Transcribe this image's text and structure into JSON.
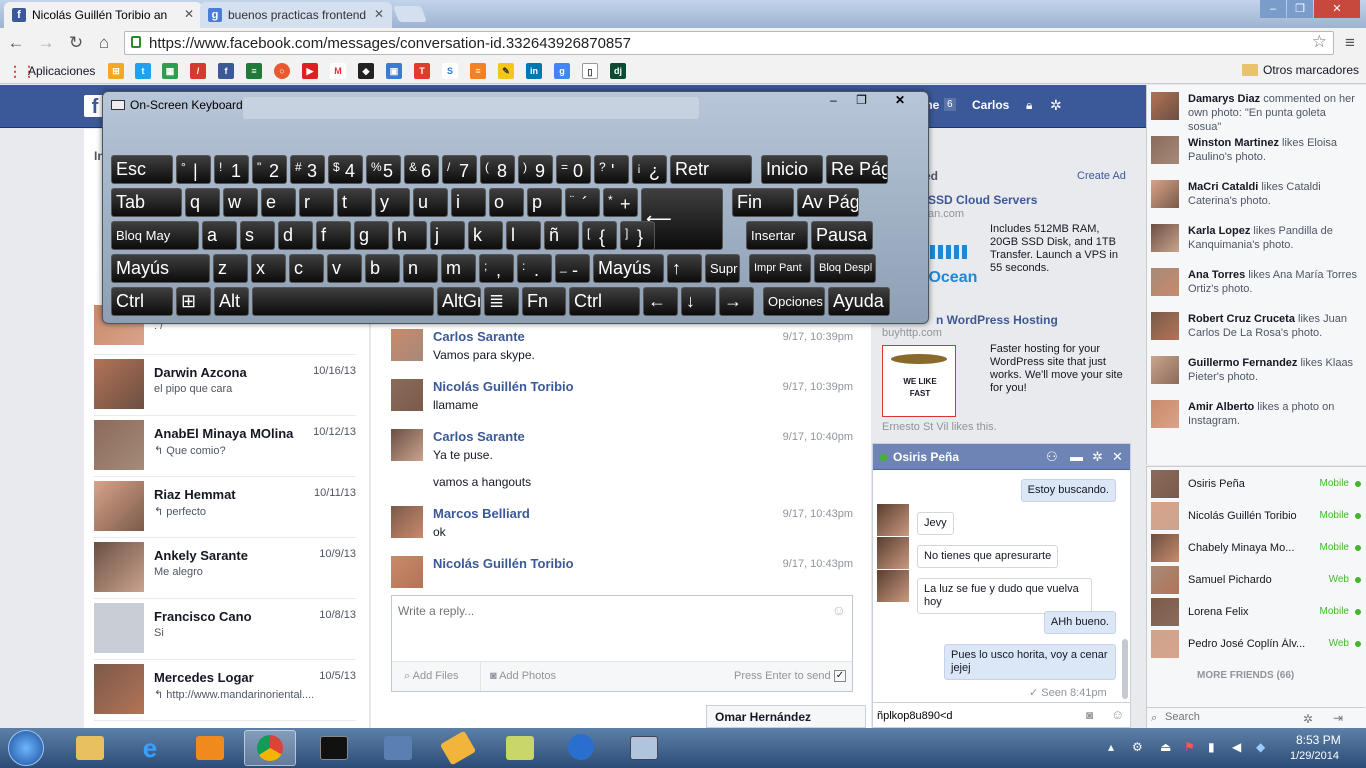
{
  "browser": {
    "tabs": [
      {
        "title": "Nicolás Guillén Toribio an",
        "icon": "facebook-icon",
        "active": true
      },
      {
        "title": "buenos practicas frontend",
        "icon": "google-icon",
        "active": false
      }
    ],
    "url": "https://www.facebook.com/messages/conversation-id.332643926870857",
    "bookmarks_label": "Aplicaciones",
    "other_bookmarks": "Otros marcadores"
  },
  "fb": {
    "home_label": "me",
    "home_count": "6",
    "user": "Carlos",
    "left_title": "Inbox",
    "conversations": [
      {
        "name": "",
        "snippet": ": /",
        "date": ""
      },
      {
        "name": "Darwin Azcona",
        "snippet": "el pipo que cara",
        "date": "10/16/13"
      },
      {
        "name": "AnabEl Minaya MOlina",
        "snippet": "↰ Que comio?",
        "date": "10/12/13"
      },
      {
        "name": "Riaz Hemmat",
        "snippet": "↰ perfecto",
        "date": "10/11/13"
      },
      {
        "name": "Ankely Sarante",
        "snippet": "Me alegro",
        "date": "10/9/13"
      },
      {
        "name": "Francisco Cano",
        "snippet": "Si",
        "date": "10/8/13"
      },
      {
        "name": "Mercedes Logar",
        "snippet": "↰ http://www.mandarinoriental....",
        "date": "10/5/13"
      }
    ],
    "messages": [
      {
        "name": "Carlos Sarante",
        "text": "Vamos para skype.",
        "time": "9/17, 10:39pm"
      },
      {
        "name": "Nicolás Guillén Toribio",
        "text": "llamame",
        "time": "9/17, 10:39pm"
      },
      {
        "name": "Carlos Sarante",
        "text": "Ya te puse.",
        "text2": "vamos a hangouts",
        "time": "9/17, 10:40pm"
      },
      {
        "name": "Marcos Belliard",
        "text": "ok",
        "time": "9/17, 10:43pm"
      },
      {
        "name": "Nicolás Guillén Toribio",
        "text": "",
        "time": "9/17, 10:43pm"
      }
    ],
    "reply_placeholder": "Write a reply...",
    "add_files": "Add Files",
    "add_photos": "Add Photos",
    "press_enter": "Press Enter to send",
    "ads": {
      "header": "ed",
      "create_ad": "Create Ad",
      "ad1_title": "SSD Cloud Servers",
      "ad1_sub": "an.com",
      "ad1_text": "Includes 512MB RAM, 20GB SSD Disk, and 1TB Transfer. Launch a VPS in 55 seconds.",
      "ad1_logo": "lOcean",
      "ad2_title": "n WordPress Hosting",
      "ad2_sub": "buyhttp.com",
      "ad2_text": "Faster hosting for your WordPress site that just works. We'll move your site for you!",
      "ad2_logo": "WE LIKE FAST",
      "ad2_like": "Ernesto St Vil likes this."
    }
  },
  "chat": {
    "name": "Osiris Peña",
    "messages": [
      {
        "text": "Estoy buscando.",
        "me": true
      },
      {
        "text": "Jevy",
        "me": false
      },
      {
        "text": "No tienes que apresurarte",
        "me": false
      },
      {
        "text": "La luz se fue y dudo que vuelva hoy",
        "me": false
      },
      {
        "text": "AHh bueno.",
        "me": true
      },
      {
        "text": "Pues lo usco horita, voy a cenar jejej",
        "me": true
      }
    ],
    "seen": "✓ Seen 8:41pm",
    "input_value": "ñplkop8u890<d",
    "other_tab": "Omar Hernández"
  },
  "ticker": [
    {
      "name": "Damarys Diaz",
      "rest": " commented on her own photo: \"En punta goleta sosua\""
    },
    {
      "name": "Winston Martinez",
      "rest": " likes Eloisa Paulino's photo."
    },
    {
      "name": "MaCri Cataldi",
      "rest": " likes Cataldi Caterina's photo."
    },
    {
      "name": "Karla Lopez",
      "rest": " likes Pandilla de Kanquimania's photo."
    },
    {
      "name": "Ana Torres",
      "rest": " likes Ana María Torres Ortiz's photo."
    },
    {
      "name": "Robert Cruz Cruceta",
      "rest": " likes Juan Carlos De La Rosa's photo."
    },
    {
      "name": "Guillermo Fernandez",
      "rest": " likes Klaas Pieter's photo."
    },
    {
      "name": "Amir Alberto",
      "rest": " likes a photo on Instagram."
    }
  ],
  "friends": [
    {
      "name": "Osiris Peña",
      "status": "Mobile"
    },
    {
      "name": "Nicolás Guillén Toribio",
      "status": "Mobile"
    },
    {
      "name": "Chabely Minaya Mo...",
      "status": "Mobile"
    },
    {
      "name": "Samuel Pichardo",
      "status": "Web"
    },
    {
      "name": "Lorena Felix",
      "status": "Mobile"
    },
    {
      "name": "Pedro José Coplín Álv...",
      "status": "Web"
    }
  ],
  "more_friends": "MORE FRIENDS (66)",
  "buddy_search": "Search",
  "osk": {
    "title": "On-Screen Keyboard",
    "rows": [
      [
        {
          "label": "Esc"
        },
        {
          "top": "°",
          "bot": "|"
        },
        {
          "top": "!",
          "bot": "1"
        },
        {
          "top": "\"",
          "bot": "2"
        },
        {
          "top": "#",
          "bot": "3"
        },
        {
          "top": "$",
          "bot": "4"
        },
        {
          "top": "%",
          "bot": "5"
        },
        {
          "top": "&",
          "bot": "6"
        },
        {
          "top": "/",
          "bot": "7"
        },
        {
          "top": "(",
          "bot": "8"
        },
        {
          "top": ")",
          "bot": "9"
        },
        {
          "top": "=",
          "bot": "0"
        },
        {
          "top": "?",
          "bot": "'"
        },
        {
          "top": "¡",
          "bot": "¿"
        },
        {
          "label": "Retr"
        },
        {
          "label": "Inicio"
        },
        {
          "label": "Re Pág"
        }
      ],
      [
        {
          "label": "Tab"
        },
        {
          "label": "q"
        },
        {
          "label": "w"
        },
        {
          "label": "e"
        },
        {
          "label": "r"
        },
        {
          "label": "t"
        },
        {
          "label": "y"
        },
        {
          "label": "u"
        },
        {
          "label": "i"
        },
        {
          "label": "o"
        },
        {
          "label": "p"
        },
        {
          "top": "¨",
          "bot": "´"
        },
        {
          "top": "*",
          "bot": "+"
        },
        {
          "label": "⟵"
        },
        {
          "label": "Fin"
        },
        {
          "label": "Av Pág"
        }
      ],
      [
        {
          "label": "Bloq May"
        },
        {
          "label": "a"
        },
        {
          "label": "s"
        },
        {
          "label": "d"
        },
        {
          "label": "f"
        },
        {
          "label": "g"
        },
        {
          "label": "h"
        },
        {
          "label": "j"
        },
        {
          "label": "k"
        },
        {
          "label": "l"
        },
        {
          "label": "ñ"
        },
        {
          "top": "[",
          "bot": "{"
        },
        {
          "top": "]",
          "bot": "}"
        },
        {
          "label": "Insertar"
        },
        {
          "label": "Pausa"
        }
      ],
      [
        {
          "label": "Mayús"
        },
        {
          "label": "z"
        },
        {
          "label": "x"
        },
        {
          "label": "c"
        },
        {
          "label": "v"
        },
        {
          "label": "b"
        },
        {
          "label": "n"
        },
        {
          "label": "m"
        },
        {
          "top": ";",
          "bot": ","
        },
        {
          "top": ":",
          "bot": "."
        },
        {
          "top": "_",
          "bot": "-"
        },
        {
          "label": "Mayús"
        },
        {
          "label": "↑"
        },
        {
          "label": "Supr"
        },
        {
          "label": "Impr Pant"
        },
        {
          "label": "Bloq Despl"
        }
      ],
      [
        {
          "label": "Ctrl"
        },
        {
          "label": "⊞"
        },
        {
          "label": "Alt"
        },
        {
          "label": ""
        },
        {
          "label": "AltGr"
        },
        {
          "label": "≣"
        },
        {
          "label": "Fn"
        },
        {
          "label": "Ctrl"
        },
        {
          "label": "←"
        },
        {
          "label": "↓"
        },
        {
          "label": "→"
        },
        {
          "label": "Opciones"
        },
        {
          "label": "Ayuda"
        }
      ]
    ]
  },
  "taskbar": {
    "time": "8:53 PM",
    "date": "1/29/2014"
  },
  "colors": {
    "fb_blue": "#3b5998",
    "online_green": "#42b72a",
    "chat_header": "#6d84b4"
  }
}
